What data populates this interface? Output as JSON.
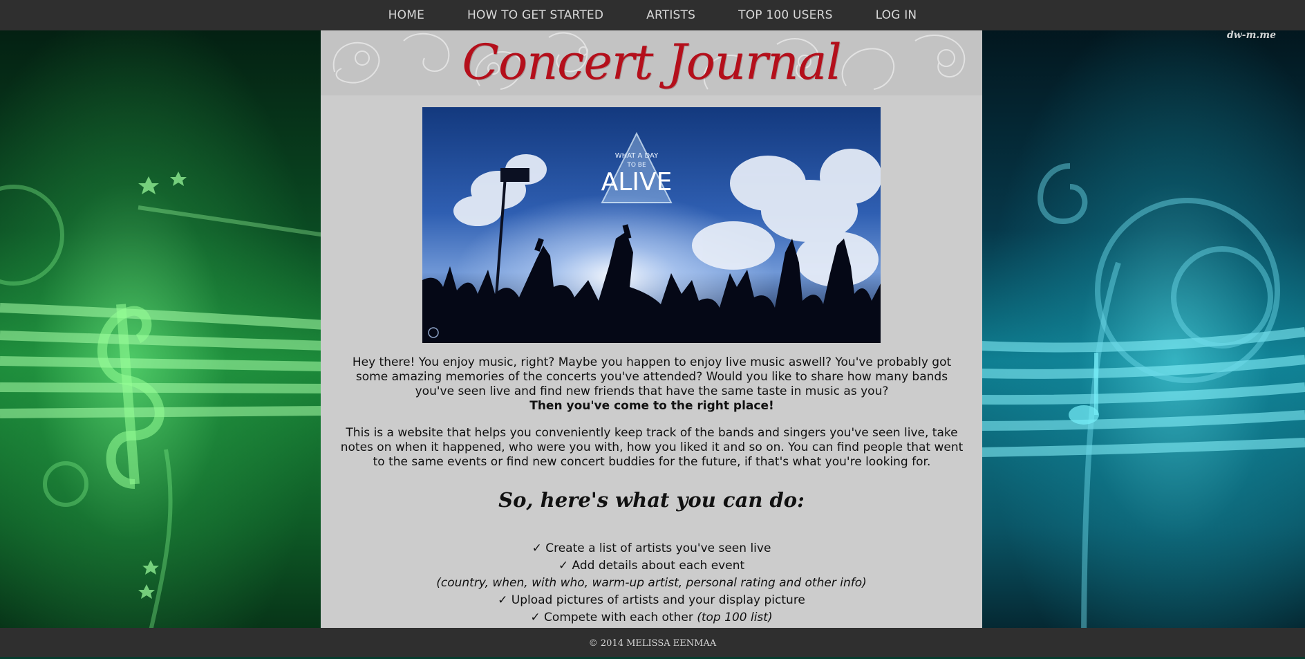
{
  "nav": {
    "items": [
      {
        "label": "HOME"
      },
      {
        "label": "HOW TO GET STARTED"
      },
      {
        "label": "ARTISTS"
      },
      {
        "label": "TOP 100 USERS"
      },
      {
        "label": "LOG IN"
      }
    ]
  },
  "background": {
    "watermark": "dw-m.me",
    "left_color": "#1c8a3a",
    "right_color": "#0f7f92"
  },
  "header": {
    "logo_text": "Concert Journal",
    "logo_color": "#b40f1b"
  },
  "hero": {
    "image_line1": "WHAT A DAY",
    "image_line2": "TO BE",
    "image_title": "ALIVE"
  },
  "intro": {
    "paragraph1": "Hey there! You enjoy music, right? Maybe you happen to enjoy live music aswell? You've probably got some amazing memories of the concerts you've attended? Would you like to share how many bands you've seen live and find new friends that have the same taste in music as you?",
    "paragraph1_emphasis": "Then you've come to the right place!",
    "paragraph2": "This is a website that helps you conveniently keep track of the bands and singers you've seen live, take notes on when it happened, who were you with, how you liked it and so on. You can find people that went to the same events or find new concert buddies for the future, if that's what you're looking for."
  },
  "features": {
    "heading": "So, here's what you can do:",
    "items": [
      {
        "text": "✓ Create a list of artists you've seen live"
      },
      {
        "text": "✓ Add details about each event"
      },
      {
        "note": "(country, when, with who, warm-up artist, personal rating and other info)"
      },
      {
        "text": "✓ Upload pictures of artists and your display picture"
      },
      {
        "text": "✓ Compete with each other ",
        "note": "(top 100 list)"
      }
    ]
  },
  "footer": {
    "copyright": "© 2014 MELISSA EENMAA"
  }
}
